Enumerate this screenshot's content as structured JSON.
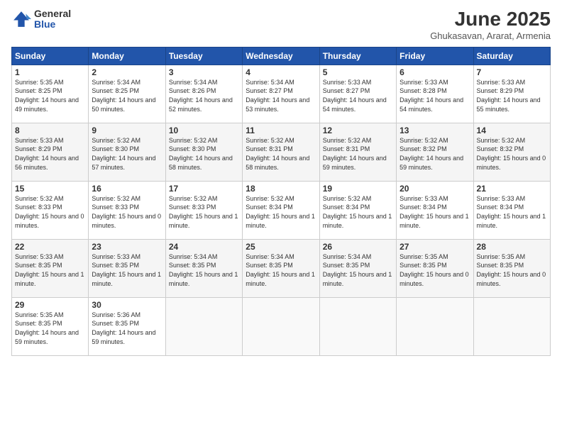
{
  "header": {
    "logo_general": "General",
    "logo_blue": "Blue",
    "month_title": "June 2025",
    "location": "Ghukasavan, Ararat, Armenia"
  },
  "weekdays": [
    "Sunday",
    "Monday",
    "Tuesday",
    "Wednesday",
    "Thursday",
    "Friday",
    "Saturday"
  ],
  "weeks": [
    [
      {
        "day": "1",
        "sunrise": "5:35 AM",
        "sunset": "8:25 PM",
        "daylight": "14 hours and 49 minutes."
      },
      {
        "day": "2",
        "sunrise": "5:34 AM",
        "sunset": "8:25 PM",
        "daylight": "14 hours and 50 minutes."
      },
      {
        "day": "3",
        "sunrise": "5:34 AM",
        "sunset": "8:26 PM",
        "daylight": "14 hours and 52 minutes."
      },
      {
        "day": "4",
        "sunrise": "5:34 AM",
        "sunset": "8:27 PM",
        "daylight": "14 hours and 53 minutes."
      },
      {
        "day": "5",
        "sunrise": "5:33 AM",
        "sunset": "8:27 PM",
        "daylight": "14 hours and 54 minutes."
      },
      {
        "day": "6",
        "sunrise": "5:33 AM",
        "sunset": "8:28 PM",
        "daylight": "14 hours and 54 minutes."
      },
      {
        "day": "7",
        "sunrise": "5:33 AM",
        "sunset": "8:29 PM",
        "daylight": "14 hours and 55 minutes."
      }
    ],
    [
      {
        "day": "8",
        "sunrise": "5:33 AM",
        "sunset": "8:29 PM",
        "daylight": "14 hours and 56 minutes."
      },
      {
        "day": "9",
        "sunrise": "5:32 AM",
        "sunset": "8:30 PM",
        "daylight": "14 hours and 57 minutes."
      },
      {
        "day": "10",
        "sunrise": "5:32 AM",
        "sunset": "8:30 PM",
        "daylight": "14 hours and 58 minutes."
      },
      {
        "day": "11",
        "sunrise": "5:32 AM",
        "sunset": "8:31 PM",
        "daylight": "14 hours and 58 minutes."
      },
      {
        "day": "12",
        "sunrise": "5:32 AM",
        "sunset": "8:31 PM",
        "daylight": "14 hours and 59 minutes."
      },
      {
        "day": "13",
        "sunrise": "5:32 AM",
        "sunset": "8:32 PM",
        "daylight": "14 hours and 59 minutes."
      },
      {
        "day": "14",
        "sunrise": "5:32 AM",
        "sunset": "8:32 PM",
        "daylight": "15 hours and 0 minutes."
      }
    ],
    [
      {
        "day": "15",
        "sunrise": "5:32 AM",
        "sunset": "8:33 PM",
        "daylight": "15 hours and 0 minutes."
      },
      {
        "day": "16",
        "sunrise": "5:32 AM",
        "sunset": "8:33 PM",
        "daylight": "15 hours and 0 minutes."
      },
      {
        "day": "17",
        "sunrise": "5:32 AM",
        "sunset": "8:33 PM",
        "daylight": "15 hours and 1 minute."
      },
      {
        "day": "18",
        "sunrise": "5:32 AM",
        "sunset": "8:34 PM",
        "daylight": "15 hours and 1 minute."
      },
      {
        "day": "19",
        "sunrise": "5:32 AM",
        "sunset": "8:34 PM",
        "daylight": "15 hours and 1 minute."
      },
      {
        "day": "20",
        "sunrise": "5:33 AM",
        "sunset": "8:34 PM",
        "daylight": "15 hours and 1 minute."
      },
      {
        "day": "21",
        "sunrise": "5:33 AM",
        "sunset": "8:34 PM",
        "daylight": "15 hours and 1 minute."
      }
    ],
    [
      {
        "day": "22",
        "sunrise": "5:33 AM",
        "sunset": "8:35 PM",
        "daylight": "15 hours and 1 minute."
      },
      {
        "day": "23",
        "sunrise": "5:33 AM",
        "sunset": "8:35 PM",
        "daylight": "15 hours and 1 minute."
      },
      {
        "day": "24",
        "sunrise": "5:34 AM",
        "sunset": "8:35 PM",
        "daylight": "15 hours and 1 minute."
      },
      {
        "day": "25",
        "sunrise": "5:34 AM",
        "sunset": "8:35 PM",
        "daylight": "15 hours and 1 minute."
      },
      {
        "day": "26",
        "sunrise": "5:34 AM",
        "sunset": "8:35 PM",
        "daylight": "15 hours and 1 minute."
      },
      {
        "day": "27",
        "sunrise": "5:35 AM",
        "sunset": "8:35 PM",
        "daylight": "15 hours and 0 minutes."
      },
      {
        "day": "28",
        "sunrise": "5:35 AM",
        "sunset": "8:35 PM",
        "daylight": "15 hours and 0 minutes."
      }
    ],
    [
      {
        "day": "29",
        "sunrise": "5:35 AM",
        "sunset": "8:35 PM",
        "daylight": "14 hours and 59 minutes."
      },
      {
        "day": "30",
        "sunrise": "5:36 AM",
        "sunset": "8:35 PM",
        "daylight": "14 hours and 59 minutes."
      },
      null,
      null,
      null,
      null,
      null
    ]
  ]
}
